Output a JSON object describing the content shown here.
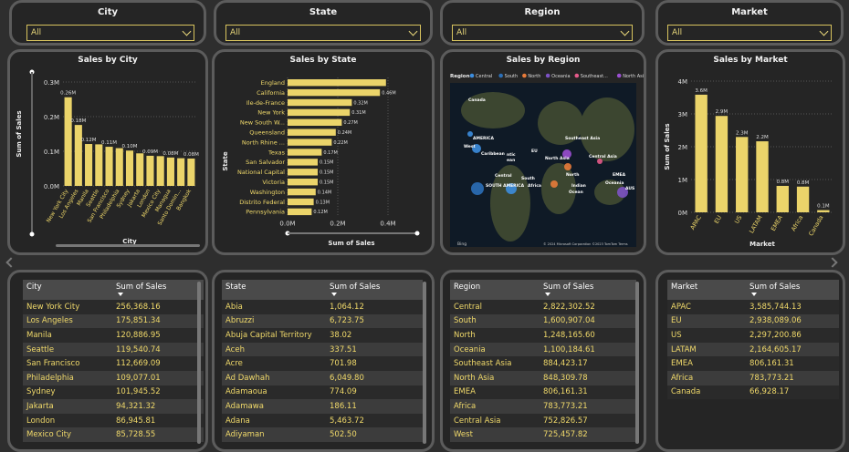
{
  "slicers": [
    {
      "title": "City",
      "value": "All"
    },
    {
      "title": "State",
      "value": "All"
    },
    {
      "title": "Region",
      "value": "All"
    },
    {
      "title": "Market",
      "value": "All"
    }
  ],
  "chart_data": [
    {
      "type": "bar",
      "title": "Sales by City",
      "xlabel": "City",
      "ylabel": "Sum of Sales",
      "ylim": [
        0,
        0.3
      ],
      "yticks": [
        "0.0M",
        "0.1M",
        "0.2M",
        "0.3M"
      ],
      "categories": [
        "New York City",
        "Los Angeles",
        "Manila",
        "Seattle",
        "San Francisco",
        "Philadelphia",
        "Sydney",
        "Jakarta",
        "London",
        "Mexico City",
        "Managua",
        "Santo Domin...",
        "Bangkok"
      ],
      "values": [
        0.256,
        0.176,
        0.121,
        0.12,
        0.113,
        0.109,
        0.102,
        0.094,
        0.087,
        0.086,
        0.082,
        0.08,
        0.079
      ],
      "labels": [
        "0.26M",
        "0.18M",
        "0.12M",
        "",
        "0.11M",
        "",
        "0.10M",
        "",
        "0.09M",
        "",
        "0.08M",
        "",
        "0.08M"
      ]
    },
    {
      "type": "bar",
      "title": "Sales by State",
      "xlabel": "Sum of Sales",
      "ylabel": "State",
      "xlim": [
        0,
        0.5
      ],
      "xticks": [
        "0.0M",
        "0.2M",
        "0.4M"
      ],
      "categories": [
        "England",
        "California",
        "Ile-de-France",
        "New York",
        "New South W...",
        "Queensland",
        "North Rhine ...",
        "Texas",
        "San Salvador",
        "National Capital",
        "Victoria",
        "Washington",
        "Distrito Federal",
        "Pennsylvania"
      ],
      "values": [
        0.49,
        0.46,
        0.32,
        0.31,
        0.27,
        0.24,
        0.22,
        0.17,
        0.15,
        0.15,
        0.15,
        0.14,
        0.13,
        0.12
      ],
      "labels": [
        "",
        "0.46M",
        "0.32M",
        "0.31M",
        "0.27M",
        "0.24M",
        "0.22M",
        "0.17M",
        "0.15M",
        "0.15M",
        "0.15M",
        "0.14M",
        "0.13M",
        "0.12M"
      ]
    },
    {
      "type": "bar",
      "title": "Sales by Market",
      "xlabel": "Market",
      "ylabel": "Sum of Sales",
      "ylim": [
        0,
        4
      ],
      "yticks": [
        "0M",
        "1M",
        "2M",
        "3M",
        "4M"
      ],
      "categories": [
        "APAC",
        "EU",
        "US",
        "LATAM",
        "EMEA",
        "Africa",
        "Canada"
      ],
      "values": [
        3.586,
        2.938,
        2.297,
        2.165,
        0.806,
        0.784,
        0.067
      ],
      "labels": [
        "3.6M",
        "2.9M",
        "2.3M",
        "2.2M",
        "0.8M",
        "0.8M",
        "0.1M"
      ]
    }
  ],
  "map": {
    "title": "Sales by Region",
    "legend_title": "Region",
    "legend": [
      {
        "name": "Central",
        "color": "#3c8dde"
      },
      {
        "name": "South",
        "color": "#2b6fb8"
      },
      {
        "name": "North",
        "color": "#e87b3a"
      },
      {
        "name": "Oceania",
        "color": "#7c52c4"
      },
      {
        "name": "Southeast...",
        "color": "#e55a8a"
      },
      {
        "name": "North Asia",
        "color": "#9b4fd1"
      }
    ],
    "labels": [
      "Canada",
      "AMERICA",
      "West",
      "Caribbean",
      "ntic",
      "ean",
      "SOUTH AMERICA",
      "Central",
      "South",
      "Southeast Asia",
      "North Asia",
      "Central Asia",
      "EU",
      "North",
      "EMEA",
      "Africa",
      "Indian",
      "Ocean",
      "Oceania",
      "AUS"
    ],
    "credit": "© 2024 Microsoft Corporation  ©2023 TomTom  Terms",
    "bing": "Bing"
  },
  "colors": {
    "bar": "#ebd46a",
    "accent": "#f0d96a"
  },
  "tables": [
    {
      "headers": [
        "City",
        "Sum of Sales"
      ],
      "rows": [
        [
          "New York City",
          "256,368.16"
        ],
        [
          "Los Angeles",
          "175,851.34"
        ],
        [
          "Manila",
          "120,886.95"
        ],
        [
          "Seattle",
          "119,540.74"
        ],
        [
          "San Francisco",
          "112,669.09"
        ],
        [
          "Philadelphia",
          "109,077.01"
        ],
        [
          "Sydney",
          "101,945.52"
        ],
        [
          "Jakarta",
          "94,321.32"
        ],
        [
          "London",
          "86,945.81"
        ],
        [
          "Mexico City",
          "85,728.55"
        ]
      ]
    },
    {
      "headers": [
        "State",
        "Sum of Sales"
      ],
      "rows": [
        [
          "Abia",
          "1,064.12"
        ],
        [
          "Abruzzi",
          "6,723.75"
        ],
        [
          "Abuja Capital Territory",
          "38.02"
        ],
        [
          "Aceh",
          "337.51"
        ],
        [
          "Acre",
          "701.98"
        ],
        [
          "Ad Dawhah",
          "6,049.80"
        ],
        [
          "Adamaoua",
          "774.09"
        ],
        [
          "Adamawa",
          "186.11"
        ],
        [
          "Adana",
          "5,463.72"
        ],
        [
          "Adiyaman",
          "502.50"
        ]
      ]
    },
    {
      "headers": [
        "Region",
        "Sum of Sales"
      ],
      "rows": [
        [
          "Central",
          "2,822,302.52"
        ],
        [
          "South",
          "1,600,907.04"
        ],
        [
          "North",
          "1,248,165.60"
        ],
        [
          "Oceania",
          "1,100,184.61"
        ],
        [
          "Southeast Asia",
          "884,423.17"
        ],
        [
          "North Asia",
          "848,309.78"
        ],
        [
          "EMEA",
          "806,161.31"
        ],
        [
          "Africa",
          "783,773.21"
        ],
        [
          "Central Asia",
          "752,826.57"
        ],
        [
          "West",
          "725,457.82"
        ]
      ]
    },
    {
      "headers": [
        "Market",
        "Sum of Sales"
      ],
      "rows": [
        [
          "APAC",
          "3,585,744.13"
        ],
        [
          "EU",
          "2,938,089.06"
        ],
        [
          "US",
          "2,297,200.86"
        ],
        [
          "LATAM",
          "2,164,605.17"
        ],
        [
          "EMEA",
          "806,161.31"
        ],
        [
          "Africa",
          "783,773.21"
        ],
        [
          "Canada",
          "66,928.17"
        ]
      ]
    }
  ]
}
